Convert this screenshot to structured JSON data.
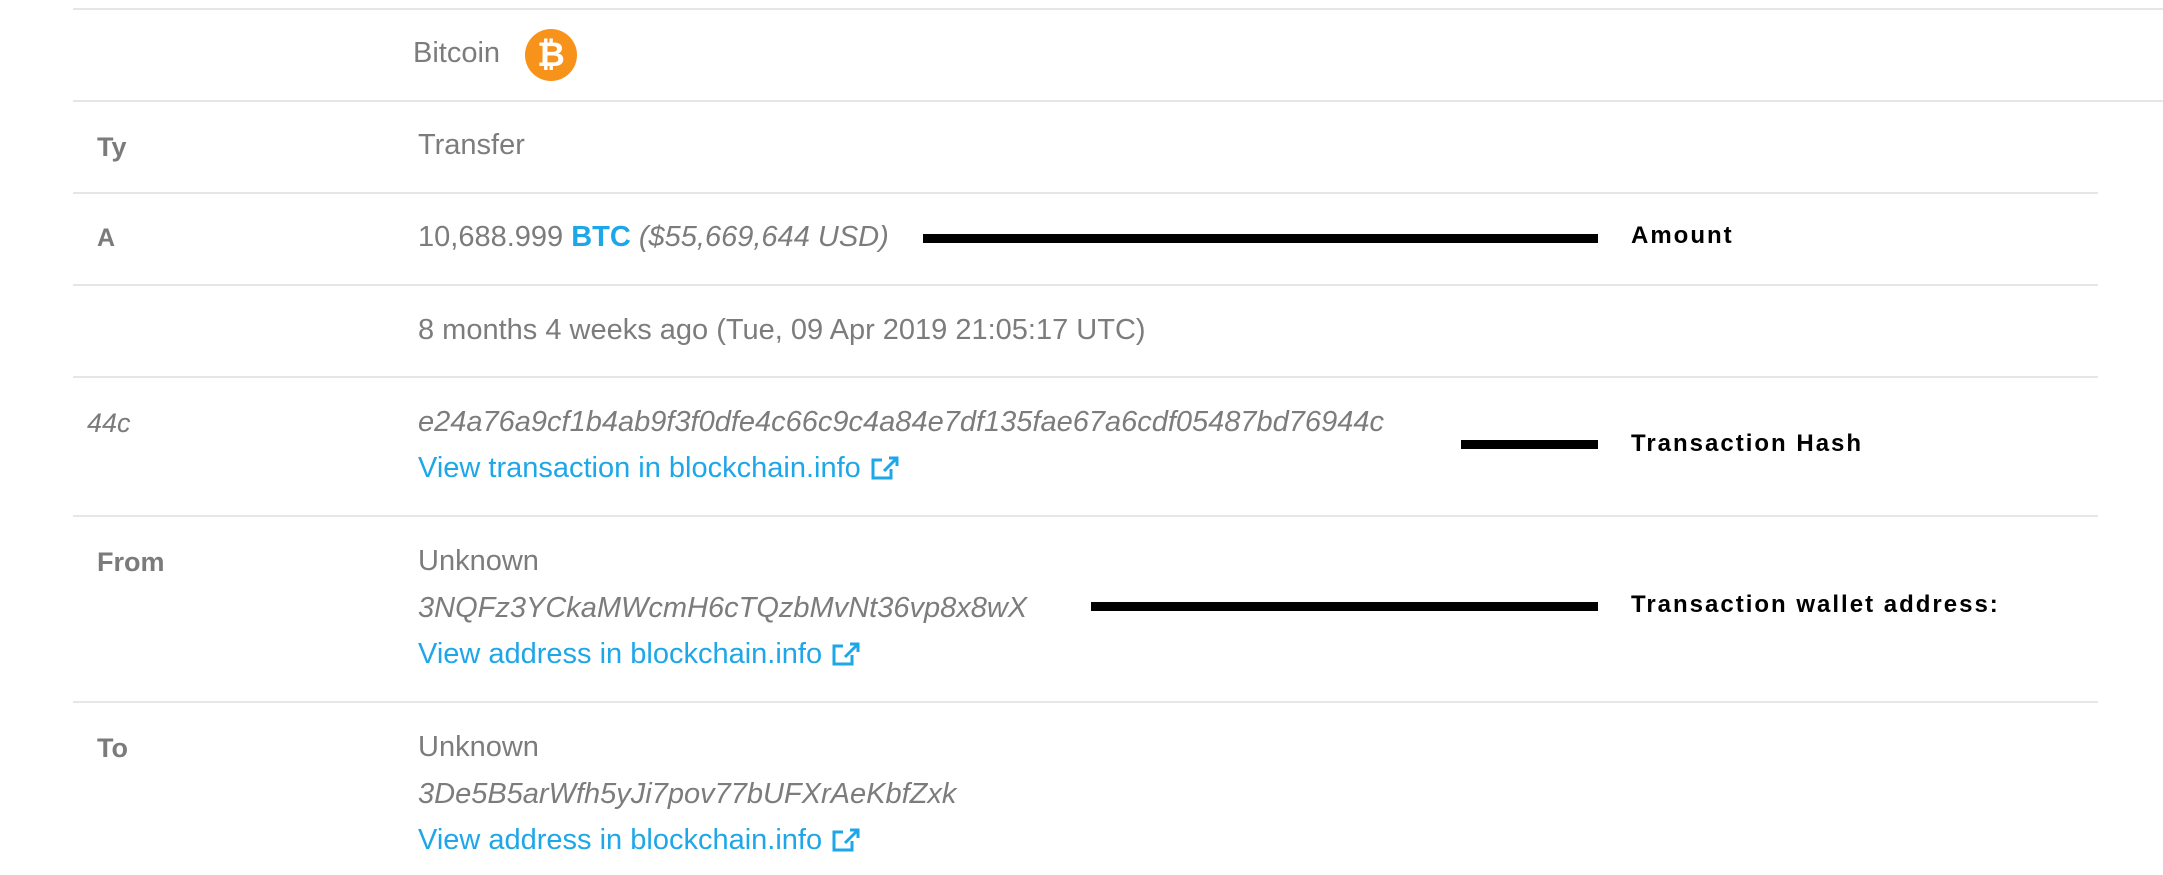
{
  "coin": {
    "name": "Bitcoin",
    "icon": "bitcoin-icon",
    "icon_glyph": "₿",
    "icon_color": "#f7931a"
  },
  "rows": {
    "type": {
      "label": "Ty",
      "value": "Transfer"
    },
    "amount": {
      "label": "A",
      "number": "10,688.999",
      "unit": "BTC",
      "usd": "($55,669,644 USD)"
    },
    "time": {
      "value": "8 months 4 weeks ago (Tue, 09 Apr 2019 21:05:17 UTC)"
    },
    "hash": {
      "label": "44c",
      "value": "e24a76a9cf1b4ab9f3f0dfe4c66c9c4a84e7df135fae67a6cdf05487bd76944c",
      "link": "View transaction in blockchain.info"
    },
    "from": {
      "label": "From",
      "owner": "Unknown",
      "address": "3NQFz3YCkaMWcmH6cTQzbMvNt36vp8x8wX",
      "link": "View address in blockchain.info"
    },
    "to": {
      "label": "To",
      "owner": "Unknown",
      "address": "3De5B5arWfh5yJi7pov77bUFXrAeKbfZxk",
      "link": "View address in blockchain.info"
    }
  },
  "annotations": {
    "amount": "Amount",
    "hash": "Transaction Hash",
    "wallet": "Transaction wallet address:"
  },
  "colors": {
    "link": "#1ea7e8",
    "text": "#7c7c7c",
    "divider": "#e6e6e6"
  },
  "icons": {
    "external_link": "external-link-icon"
  }
}
